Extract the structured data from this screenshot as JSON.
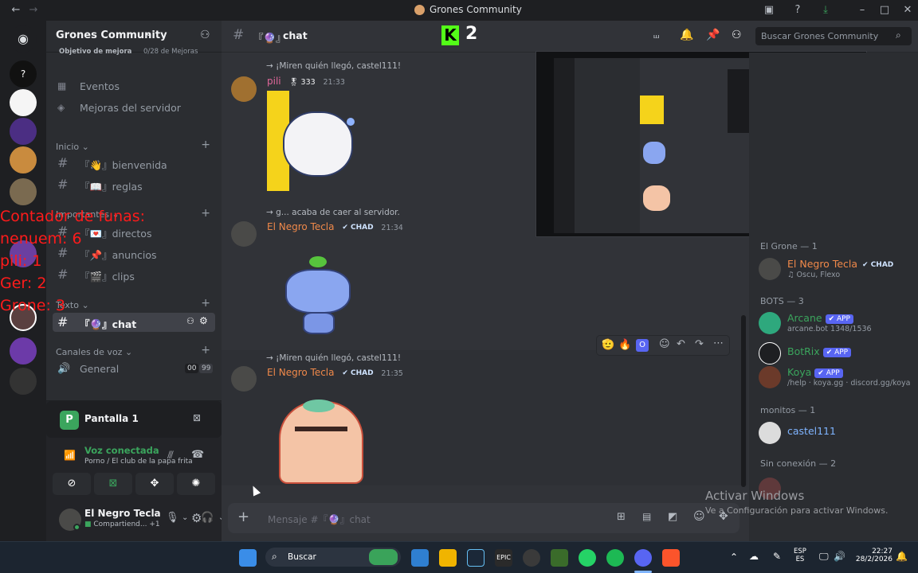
{
  "window": {
    "title": "Grones Community",
    "search_placeholder": "Buscar Grones Community",
    "kick_count": "2"
  },
  "guild": {
    "name": "Grones Community",
    "boost_label": "Objetivo de mejora",
    "boost_count": "0/28 de Mejoras",
    "events_label": "Eventos",
    "boosts_label": "Mejoras del servidor"
  },
  "categories": {
    "inicio": "Inicio",
    "importantes": "Importantes",
    "texto": "Texto",
    "voz": "Canales de voz"
  },
  "channels": [
    {
      "label": "『👋』bienvenida"
    },
    {
      "label": "『📖』reglas"
    },
    {
      "label": "『💌』directos"
    },
    {
      "label": "『📌』anuncios"
    },
    {
      "label": "『🎬』clips"
    },
    {
      "label": "『🔮』chat"
    }
  ],
  "voice_channel": {
    "label": "General",
    "count_a": "00",
    "count_b": "99"
  },
  "voice_panel": {
    "screen_title": "Pantalla 1",
    "status": "Voz conectada",
    "channel": "Porno / El club de la papa frita"
  },
  "user_panel": {
    "name": "El Negro Tecla",
    "status": "Compartiend...",
    "extra": "+1"
  },
  "chat": {
    "channel_name": "chat",
    "channel_prefix": "『🔮』",
    "composer_placeholder": "Mensaje #『🔮』chat",
    "messages": [
      {
        "reply": "→ ¡Miren quién llegó, castel111!",
        "author": "pili",
        "badge": "333",
        "time": "21:33"
      },
      {
        "reply": "→ g... acaba de caer al servidor.",
        "author": "El Negro Tecla",
        "badge": "CHAD",
        "time": "21:34"
      },
      {
        "reply": "→ ¡Miren quién llegó, castel111!",
        "author": "El Negro Tecla",
        "badge": "CHAD",
        "time": "21:35"
      }
    ]
  },
  "members": {
    "group1": "El Grone — 1",
    "m1": {
      "name": "El Negro Tecla",
      "badge": "CHAD",
      "sub": "Oscu, Flexo"
    },
    "group2": "BOTS — 3",
    "bots": [
      {
        "name": "Arcane",
        "badge": "APP",
        "sub": "arcane.bot 1348/1536"
      },
      {
        "name": "BotRix",
        "badge": "APP",
        "sub": ""
      },
      {
        "name": "Koya",
        "badge": "APP",
        "sub": "/help · koya.gg · discord.gg/koya"
      }
    ],
    "group3": "monitos — 1",
    "m3": {
      "name": "castel111"
    },
    "group4": "Sin conexión — 2"
  },
  "overlay": {
    "text": "Contador de funas:\nnenuem: 6\npili: 1\nGer: 2\nGrone: 3"
  },
  "watermark": {
    "title": "Activar Windows",
    "subtitle": "Ve a Configuración para activar Windows."
  },
  "taskbar": {
    "search": "Buscar",
    "lang1": "ESP",
    "lang2": "ES",
    "time": "22:27",
    "date": "28/2/2026"
  },
  "colors": {
    "blurple": "#5865f2",
    "orange_name": "#f0894a",
    "pink_name": "#e0679a",
    "green_name": "#3ba55d",
    "blue_name": "#7fb4ff",
    "overlay_red": "#ff1b1b"
  }
}
